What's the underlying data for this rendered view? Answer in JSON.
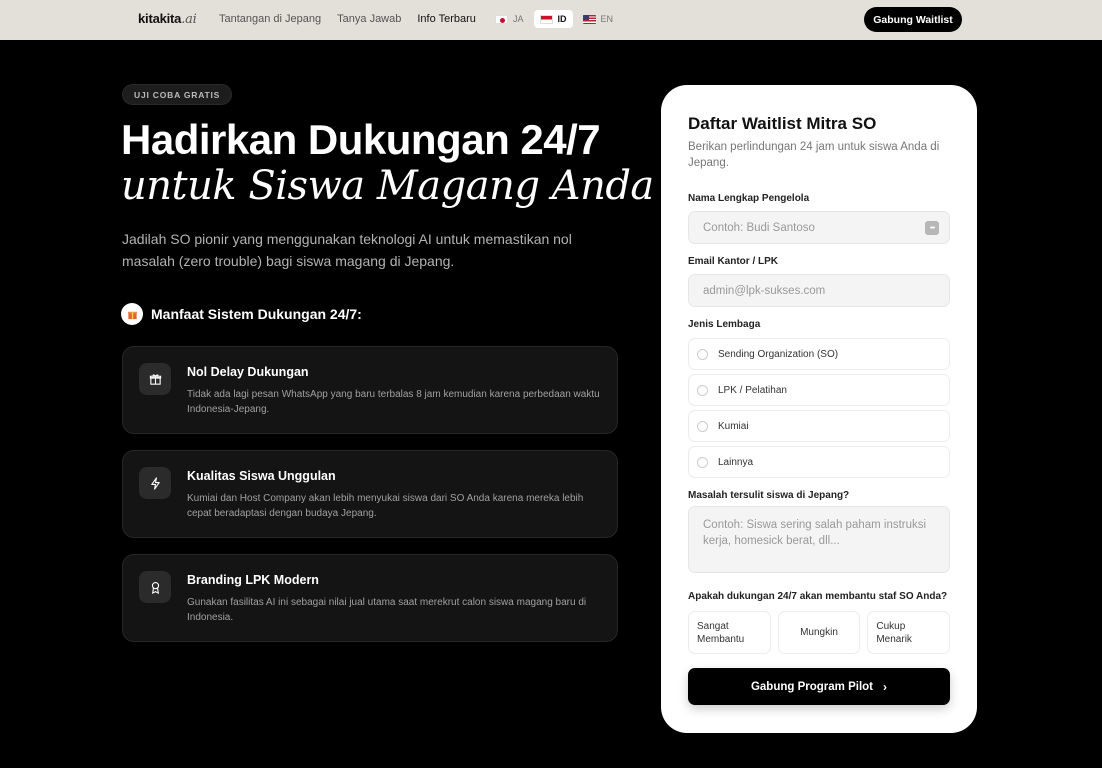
{
  "nav": {
    "logo_main": "kitakita",
    "logo_suffix": ".ai",
    "links": [
      "Tantangan di Jepang",
      "Tanya Jawab",
      "Info Terbaru"
    ],
    "langs": [
      {
        "code": "JA",
        "flag": "japan-flag-icon"
      },
      {
        "code": "ID",
        "flag": "indonesia-flag-icon"
      },
      {
        "code": "EN",
        "flag": "usa-flag-icon"
      }
    ],
    "cta": "Gabung Waitlist"
  },
  "hero": {
    "badge": "UJI COBA GRATIS",
    "title_line1": "Hadirkan Dukungan 24/7",
    "title_line2": "untuk Siswa Magang Anda",
    "lead": "Jadilah SO pionir yang menggunakan teknologi AI untuk memastikan nol masalah (zero trouble) bagi siswa magang di Jepang.",
    "benefits_title": "Manfaat Sistem Dukungan 24/7:"
  },
  "cards": [
    {
      "icon": "gift-icon",
      "title": "Nol Delay Dukungan",
      "desc": "Tidak ada lagi pesan WhatsApp yang baru terbalas 8 jam kemudian karena perbedaan waktu Indonesia-Jepang."
    },
    {
      "icon": "lightning-icon",
      "title": "Kualitas Siswa Unggulan",
      "desc": "Kumiai dan Host Company akan lebih menyukai siswa dari SO Anda karena mereka lebih cepat beradaptasi dengan budaya Jepang."
    },
    {
      "icon": "award-icon",
      "title": "Branding LPK Modern",
      "desc": "Gunakan fasilitas AI ini sebagai nilai jual utama saat merekrut calon siswa magang baru di Indonesia."
    }
  ],
  "form": {
    "title": "Daftar Waitlist Mitra SO",
    "subtitle": "Berikan perlindungan 24 jam untuk siswa Anda di Jepang.",
    "name_label": "Nama Lengkap Pengelola",
    "name_placeholder": "Contoh: Budi Santoso",
    "email_label": "Email Kantor / LPK",
    "email_placeholder": "admin@lpk-sukses.com",
    "type_label": "Jenis Lembaga",
    "types": [
      "Sending Organization (SO)",
      "LPK / Pelatihan",
      "Kumiai",
      "Lainnya"
    ],
    "problem_label": "Masalah tersulit siswa di Jepang?",
    "problem_placeholder": "Contoh: Siswa sering salah paham instruksi kerja, homesick berat, dll...",
    "help_label": "Apakah dukungan 24/7 akan membantu staf SO Anda?",
    "help_options": [
      "Sangat Membantu",
      "Mungkin",
      "Cukup Menarik"
    ],
    "submit": "Gabung Program Pilot"
  }
}
